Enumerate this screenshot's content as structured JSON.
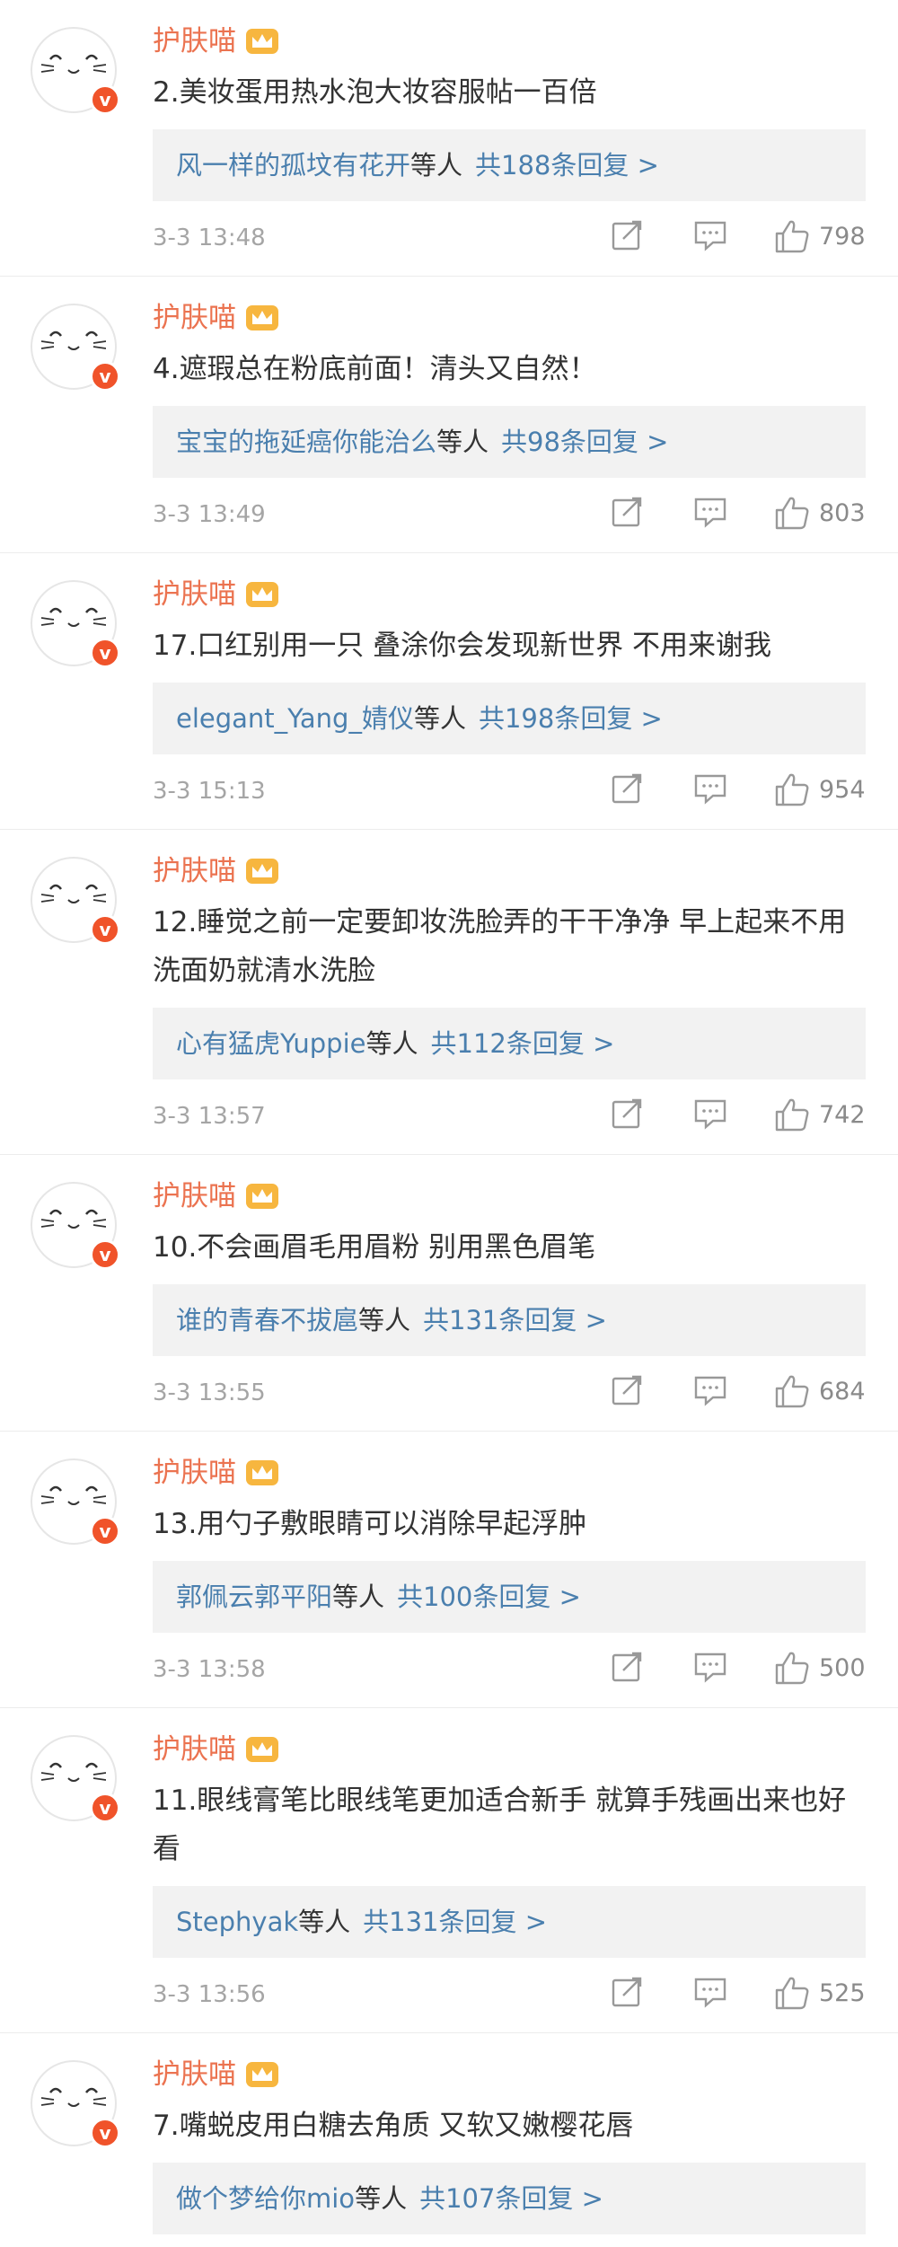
{
  "comments": [
    {
      "user": "护肤喵",
      "text": "2.美妆蛋用热水泡大妆容服帖一百倍",
      "reply_names": "风一样的孤坟有花开",
      "reply_etc": "等人",
      "reply_count": "共188条回复 >",
      "time": "3-3 13:48",
      "likes": "798"
    },
    {
      "user": "护肤喵",
      "text": "4.遮瑕总在粉底前面！清头又自然！",
      "reply_names": "宝宝的拖延癌你能治么",
      "reply_etc": "等人",
      "reply_count": "共98条回复 >",
      "time": "3-3 13:49",
      "likes": "803"
    },
    {
      "user": "护肤喵",
      "text": "17.口红别用一只 叠涂你会发现新世界 不用来谢我",
      "reply_names": "elegant_Yang_婧仪",
      "reply_etc": "等人",
      "reply_count": "共198条回复 >",
      "time": "3-3 15:13",
      "likes": "954"
    },
    {
      "user": "护肤喵",
      "text": "12.睡觉之前一定要卸妆洗脸弄的干干净净 早上起来不用洗面奶就清水洗脸",
      "reply_names": "心有猛虎Yuppie",
      "reply_etc": "等人",
      "reply_count": "共112条回复 >",
      "time": "3-3 13:57",
      "likes": "742"
    },
    {
      "user": "护肤喵",
      "text": "10.不会画眉毛用眉粉 别用黑色眉笔",
      "reply_names": "谁的青春不拔扈",
      "reply_etc": "等人",
      "reply_count": "共131条回复 >",
      "time": "3-3 13:55",
      "likes": "684"
    },
    {
      "user": "护肤喵",
      "text": "13.用勺子敷眼睛可以消除早起浮肿",
      "reply_names": "郭佩云郭平阳",
      "reply_etc": "等人",
      "reply_count": "共100条回复 >",
      "time": "3-3 13:58",
      "likes": "500"
    },
    {
      "user": "护肤喵",
      "text": "11.眼线膏笔比眼线笔更加适合新手 就算手残画出来也好看",
      "reply_names": "Stephyak",
      "reply_etc": "等人",
      "reply_count": "共131条回复 >",
      "time": "3-3 13:56",
      "likes": "525"
    },
    {
      "user": "护肤喵",
      "text": "7.嘴蜕皮用白糖去角质 又软又嫩樱花唇",
      "reply_names": "做个梦给你mio",
      "reply_etc": "等人",
      "reply_count": "共107条回复 >",
      "time": "",
      "likes": ""
    }
  ],
  "badge": "v",
  "colors": {
    "username": "#eb7350",
    "link": "#4a7fae",
    "badge": "#f0532a",
    "reply_bg": "#f2f2f2"
  },
  "icons": {
    "avatar": "cat-face-avatar",
    "crown": "crown-icon",
    "share": "share-icon",
    "comment": "comment-icon",
    "like": "thumbs-up-icon"
  }
}
